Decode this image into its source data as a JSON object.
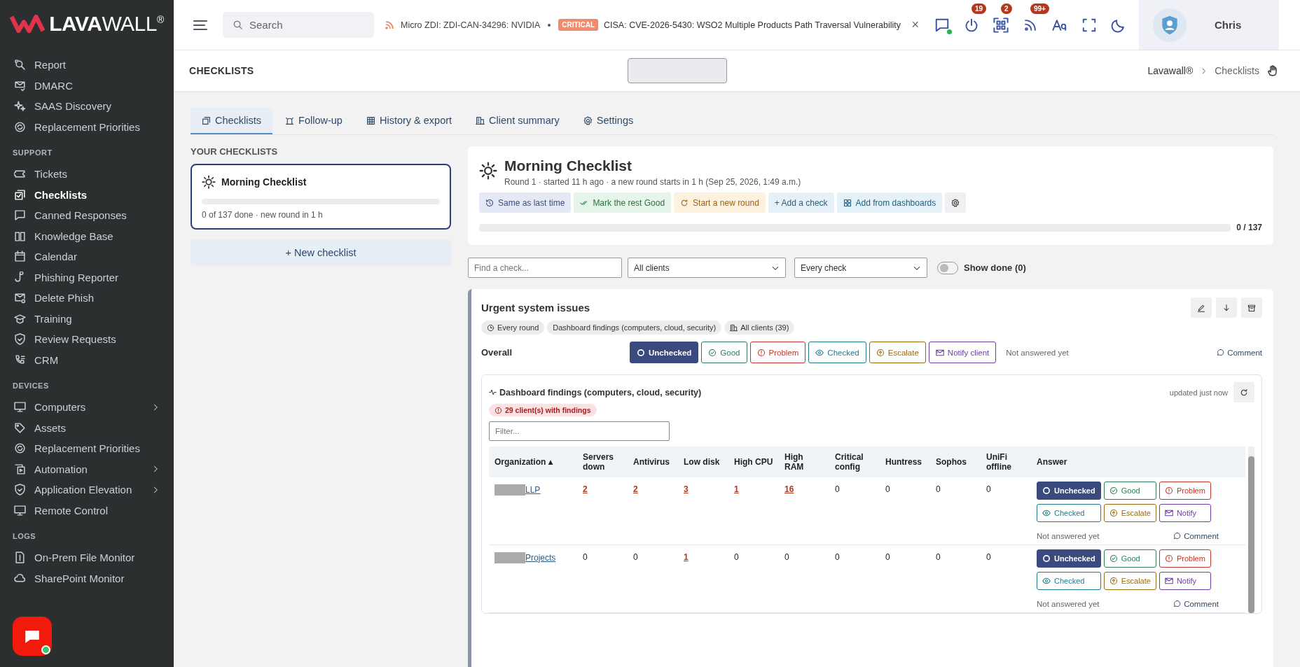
{
  "brand": {
    "logo": "**LAVA**WALL$^{®}$"
  },
  "sidebar": {
    "sections": [
      {
        "items": [
          {
            "label": "Report",
            "selected": false,
            "expandable": false
          },
          {
            "label": "DMARC",
            "selected": false,
            "expandable": false
          },
          {
            "label": "SAAS Discovery",
            "selected": false,
            "expandable": false
          },
          {
            "label": "Replacement Priorities",
            "selected": false,
            "expandable": false
          }
        ]
      },
      {
        "heading": "SUPPORT",
        "items": [
          {
            "label": "Tickets",
            "selected": false,
            "expandable": false
          },
          {
            "label": "Checklists",
            "selected": true,
            "expandable": false
          },
          {
            "label": "Canned Responses",
            "selected": false,
            "expandable": false
          },
          {
            "label": "Knowledge Base",
            "selected": false,
            "expandable": false
          },
          {
            "label": "Calendar",
            "selected": false,
            "expandable": false
          },
          {
            "label": "Phishing Reporter",
            "selected": false,
            "expandable": false
          },
          {
            "label": "Delete Phish",
            "selected": false,
            "expandable": false
          },
          {
            "label": "Training",
            "selected": false,
            "expandable": false
          },
          {
            "label": "Review Requests",
            "selected": false,
            "expandable": false
          },
          {
            "label": "CRM",
            "selected": false,
            "expandable": false
          }
        ]
      },
      {
        "heading": "DEVICES",
        "items": [
          {
            "label": "Computers",
            "selected": false,
            "expandable": true
          },
          {
            "label": "Assets",
            "selected": false,
            "expandable": false
          },
          {
            "label": "Replacement Priorities",
            "selected": false,
            "expandable": false
          },
          {
            "label": "Automation",
            "selected": false,
            "expandable": true
          },
          {
            "label": "Application Elevation",
            "selected": false,
            "expandable": true
          },
          {
            "label": "Remote Control",
            "selected": false,
            "expandable": false
          }
        ]
      },
      {
        "heading": "LOGS",
        "items": [
          {
            "label": "On-Prem File Monitor",
            "selected": false,
            "expandable": false
          },
          {
            "label": "SharePoint Monitor",
            "selected": false,
            "expandable": false
          }
        ]
      }
    ]
  },
  "topbar": {
    "search": {
      "placeholder": "Search"
    },
    "ticker": [
      {
        "text": "Micro ZDI: ZDI-CAN-34296: NVIDIA"
      },
      {
        "text": "CISA: CVE-2026-5430: WSO2 Multiple Products Path Traversal Vulnerability",
        "badge": "CRITICAL"
      }
    ],
    "ticker_close": "×",
    "actions": [
      {
        "kind": "chat",
        "online": true
      },
      {
        "kind": "power",
        "badge": "19",
        "online": false
      },
      {
        "kind": "qr",
        "badge": "2",
        "online": false
      },
      {
        "kind": "rss",
        "badge": "99+",
        "online": false
      },
      {
        "kind": "font",
        "online": false
      },
      {
        "kind": "fullscreen",
        "online": false
      },
      {
        "kind": "moon",
        "online": false
      }
    ],
    "user": {
      "name": "Chris"
    }
  },
  "page_header": {
    "title": "CHECKLISTS",
    "breadcrumb": [
      {
        "label": "Lavawall®",
        "current": false
      },
      {
        "label": "Checklists",
        "current": true
      }
    ]
  },
  "tabs": [
    {
      "label": "Checklists",
      "selected": true
    },
    {
      "label": "Follow-up",
      "selected": false
    },
    {
      "label": "History & export",
      "selected": false
    },
    {
      "label": "Client summary",
      "selected": false
    },
    {
      "label": "Settings",
      "selected": false
    }
  ],
  "your_checklists": {
    "heading": "YOUR CHECKLISTS",
    "items": [
      {
        "name": "Morning Checklist",
        "selected": true,
        "level": 0,
        "meta": "0 of 137 done · new round in 1 h"
      }
    ],
    "new_button": "+ New checklist"
  },
  "checklist": {
    "title": "Morning Checklist",
    "subtitle": "Round 1 · started 11 h ago · a new round starts in 1 h (Sep 25, 2026, 1:49 a.m.)",
    "actions": [
      {
        "label": "Same as last time",
        "kind": "history"
      },
      {
        "label": "Mark the rest Good",
        "kind": "good"
      },
      {
        "label": "Start a new round",
        "kind": "round"
      },
      {
        "label": "+ Add a check",
        "kind": "add"
      },
      {
        "label": "Add from dashboards",
        "kind": "dashboards"
      },
      {
        "kind": "settings"
      }
    ],
    "level": 0,
    "progress": "0 / 137"
  },
  "filters": {
    "search": {
      "placeholder": "Find a check..."
    },
    "client": "All clients",
    "check": "Every check",
    "show_done": {
      "label": "Show done (0)",
      "on": false
    }
  },
  "section": {
    "title": "Urgent system issues",
    "chips": [
      {
        "label": "Every round",
        "kind": "clock"
      },
      {
        "label": "Dashboard findings (computers, cloud, security)",
        "kind": "plain"
      },
      {
        "label": "All clients (39)",
        "kind": "building"
      }
    ],
    "overall": {
      "label": "Overall",
      "answers": [
        {
          "label": "Unchecked",
          "kind": "unchecked",
          "selected": true
        },
        {
          "label": "Good",
          "kind": "good",
          "selected": false
        },
        {
          "label": "Problem",
          "kind": "problem",
          "selected": false
        },
        {
          "label": "Checked",
          "kind": "checked",
          "selected": false
        },
        {
          "label": "Escalate",
          "kind": "escalate",
          "selected": false
        },
        {
          "label": "Notify client",
          "kind": "notify",
          "selected": false
        }
      ],
      "status": "Not answered yet",
      "comment": "Comment"
    },
    "findings": {
      "title": "Dashboard findings (computers, cloud, security)",
      "updated": "updated just now",
      "badge": "29 client(s) with findings",
      "filter": {
        "placeholder": "Filter..."
      },
      "columns": [
        "Organization ▴",
        "Servers down",
        "Antivirus",
        "Low disk",
        "High CPU",
        "High RAM",
        "Critical config",
        "Huntress",
        "Sophos",
        "UniFi offline",
        "Answer"
      ],
      "rows": [
        {
          "cells": [
            {
              "text": "LLP",
              "kind": "organization",
              "flagged": false
            },
            {
              "text": "2",
              "flagged": true
            },
            {
              "text": "2",
              "flagged": true
            },
            {
              "text": "3",
              "flagged": true
            },
            {
              "text": "1",
              "flagged": true
            },
            {
              "text": "16",
              "flagged": true
            },
            {
              "text": "0",
              "flagged": false
            },
            {
              "text": "0",
              "flagged": false
            },
            {
              "text": "0",
              "flagged": false
            },
            {
              "text": "0",
              "flagged": false
            }
          ],
          "answers": [
            {
              "label": "Unchecked",
              "kind": "unchecked",
              "selected": true
            },
            {
              "label": "Good",
              "kind": "good",
              "selected": false
            },
            {
              "label": "Problem",
              "kind": "problem",
              "selected": false
            },
            {
              "label": "Checked",
              "kind": "checked",
              "selected": false
            },
            {
              "label": "Escalate",
              "kind": "escalate",
              "selected": false
            },
            {
              "label": "Notify",
              "kind": "notify",
              "selected": false
            }
          ],
          "status": "Not answered yet",
          "comment": "Comment"
        },
        {
          "cells": [
            {
              "text": "Projects",
              "kind": "organization",
              "flagged": false
            },
            {
              "text": "0",
              "flagged": false
            },
            {
              "text": "0",
              "flagged": false
            },
            {
              "text": "1",
              "flagged": true
            },
            {
              "text": "0",
              "flagged": false
            },
            {
              "text": "0",
              "flagged": false
            },
            {
              "text": "0",
              "flagged": false
            },
            {
              "text": "0",
              "flagged": false
            },
            {
              "text": "0",
              "flagged": false
            },
            {
              "text": "0",
              "flagged": false
            }
          ],
          "answers": [
            {
              "label": "Unchecked",
              "kind": "unchecked",
              "selected": true
            },
            {
              "label": "Good",
              "kind": "good",
              "selected": false
            },
            {
              "label": "Problem",
              "kind": "problem",
              "selected": false
            },
            {
              "label": "Checked",
              "kind": "checked",
              "selected": false
            },
            {
              "label": "Escalate",
              "kind": "escalate",
              "selected": false
            },
            {
              "label": "Notify",
              "kind": "notify",
              "selected": false
            }
          ],
          "status": "Not answered yet",
          "comment": "Comment"
        }
      ]
    }
  }
}
